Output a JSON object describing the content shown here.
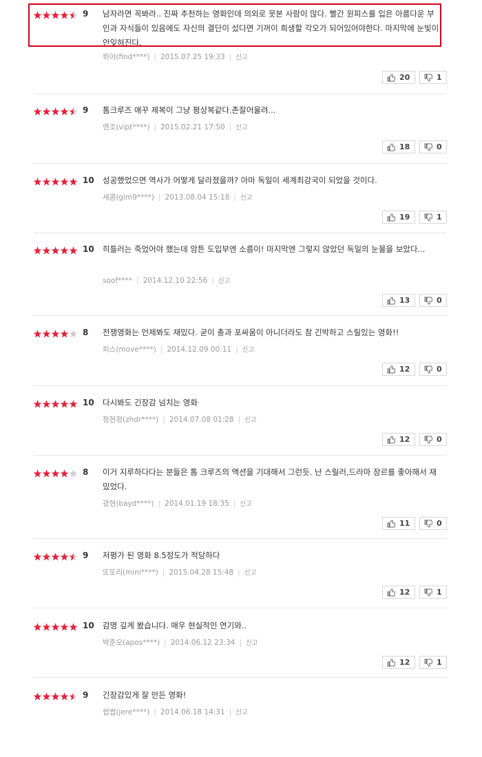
{
  "colors": {
    "star_on": "#e8213b",
    "star_off": "#cccccc",
    "highlight_border": "#d0021b"
  },
  "report_label": "신고",
  "reviews": [
    {
      "stars": 4.5,
      "score": "9",
      "text": "남자라면 꼭봐라.. 진짜 추천하는 영화인데 의외로 못본 사람이 많다. 빨간 원피스를 입은 아름다운 부인과 자식들이 있음에도 자신의 결단이 섰다면 기꺼이 희생할 각오가 되어있어야한다. 마지막에 눈빛이 안잊혀진다.",
      "user": "뤼야(find****)",
      "date": "2015.07.25 19:33",
      "up": "20",
      "down": "1"
    },
    {
      "stars": 4.5,
      "score": "9",
      "text": "톰크루즈 애꾸 제복이 그냥 평상복같다.존잘어울려...",
      "user": "엔조(vipt****)",
      "date": "2015.02.21 17:50",
      "up": "18",
      "down": "0"
    },
    {
      "stars": 5,
      "score": "10",
      "text": "성공했었으면 역사가 어떻게 달라졌을까? 아마 독일이 세계최강국이 되었을 것이다.",
      "user": "세콤(gim9****)",
      "date": "2013.08.04 15:18",
      "up": "19",
      "down": "1"
    },
    {
      "stars": 5,
      "score": "10",
      "text": "히틀러는 죽었어야 했는데 암튼 도입부엔 소름이! 마지막엔 그렇지 않았던 독일의 눈물을 보았다...",
      "user": "soof****",
      "date": "2014.12.10 22:56",
      "up": "13",
      "down": "0"
    },
    {
      "stars": 4,
      "score": "8",
      "text": "전쟁영화는 언제봐도 재밌다. 굳이 총과 포싸움이 아니더라도 참 긴박하고 스릴있는 영화!!",
      "user": "피스(move****)",
      "date": "2014.12.09 00:11",
      "up": "12",
      "down": "0"
    },
    {
      "stars": 5,
      "score": "10",
      "text": "다시봐도 긴장감 넘치는 영화",
      "user": "정현정(zhdr****)",
      "date": "2014.07.08 01:28",
      "up": "12",
      "down": "0"
    },
    {
      "stars": 4,
      "score": "8",
      "text": "이거 지루하다다는 분들은 톰 크루즈의 액션을 기대해서 그런듯. 난 스릴러,드라마 장르를 좋아해서 재밌었다.",
      "user": "광현(bayd****)",
      "date": "2014.01.19 18:35",
      "up": "11",
      "down": "0"
    },
    {
      "stars": 4.5,
      "score": "9",
      "text": "저평가 된 영화 8.5정도가 적당하다",
      "user": "또또리(mini****)",
      "date": "2015.04.28 15:48",
      "up": "12",
      "down": "1"
    },
    {
      "stars": 5,
      "score": "10",
      "text": "감명 깊게 봤습니다. 매우 현실적인 연기와..",
      "user": "박준오(apos****)",
      "date": "2014.06.12 23:34",
      "up": "12",
      "down": "1"
    },
    {
      "stars": 4.5,
      "score": "9",
      "text": "긴장감있게 잘 만든 영화!",
      "user": "썹썹(jere****)",
      "date": "2014.06.18 14:31",
      "up": null,
      "down": null
    }
  ]
}
